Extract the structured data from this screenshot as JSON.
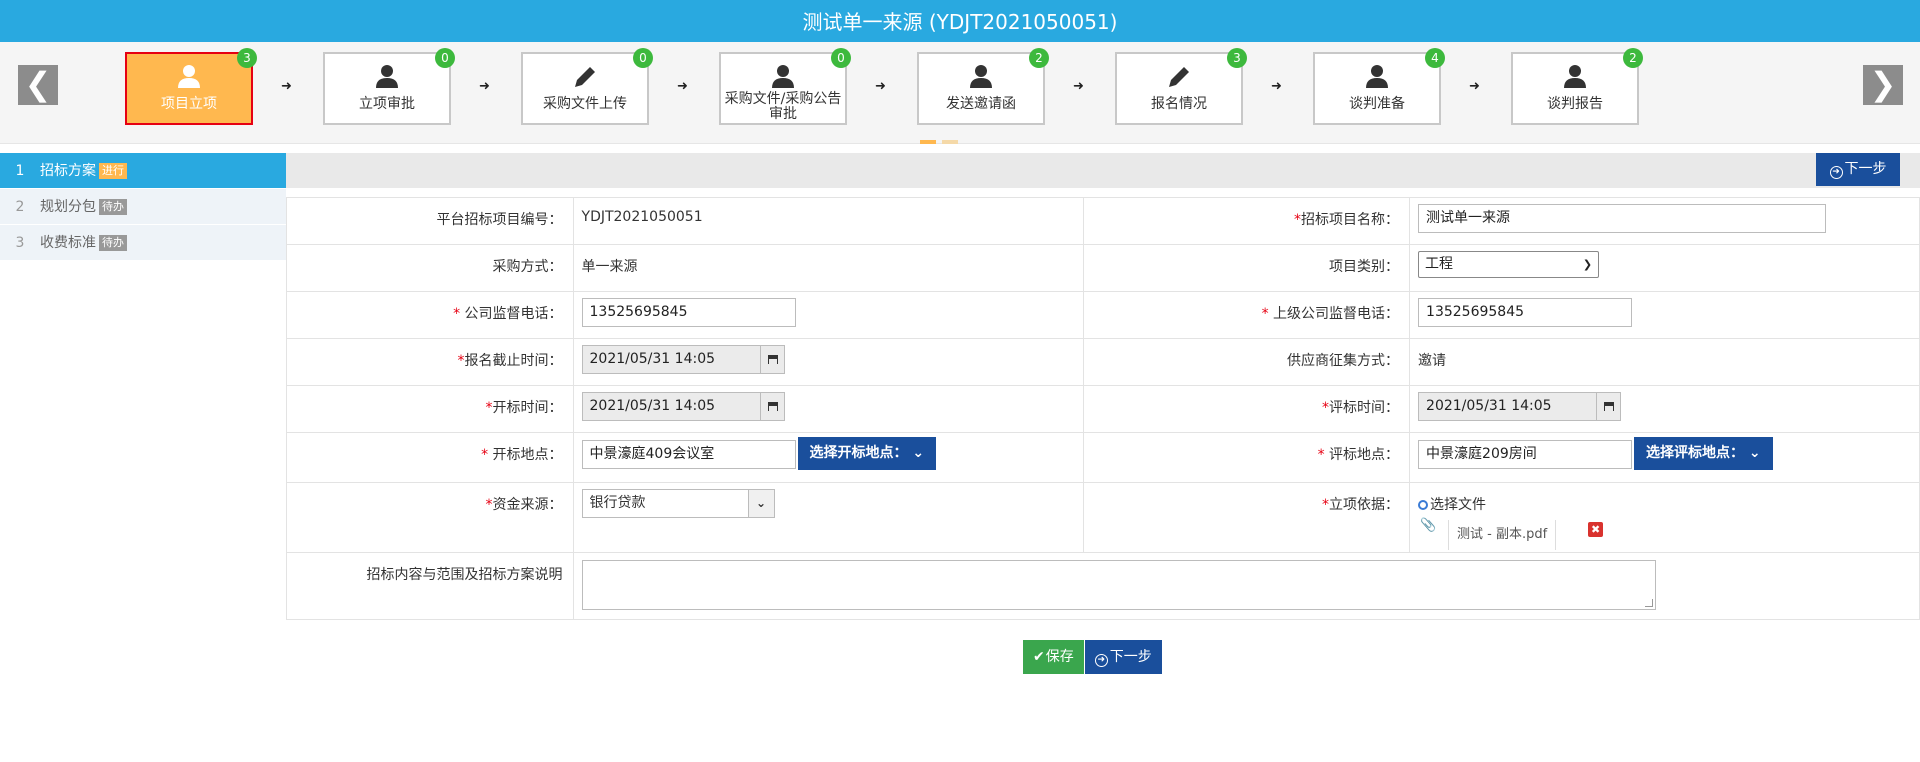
{
  "title": "测试单一来源 (YDJT2021050051)",
  "steps": [
    {
      "label": "项目立项",
      "badge": "3",
      "icon": "user-icon"
    },
    {
      "label": "立项审批",
      "badge": "0",
      "icon": "user-icon"
    },
    {
      "label": "采购文件上传",
      "badge": "0",
      "icon": "pencil-icon"
    },
    {
      "label": "采购文件/采购公告审批",
      "badge": "0",
      "icon": "user-icon"
    },
    {
      "label": "发送邀请函",
      "badge": "2",
      "icon": "user-icon"
    },
    {
      "label": "报名情况",
      "badge": "3",
      "icon": "pencil-icon"
    },
    {
      "label": "谈判准备",
      "badge": "4",
      "icon": "user-icon"
    },
    {
      "label": "谈判报告",
      "badge": "2",
      "icon": "user-icon"
    }
  ],
  "nav": {
    "prev": "❮",
    "next": "❯"
  },
  "sidebar": [
    {
      "num": "1",
      "label": "招标方案",
      "tag": "进行"
    },
    {
      "num": "2",
      "label": "规划分包",
      "tag": "待办"
    },
    {
      "num": "3",
      "label": "收费标准",
      "tag": "待办"
    }
  ],
  "toolbar": {
    "next_label": "下一步"
  },
  "form": {
    "project_no_label": "平台招标项目编号：",
    "project_no": "YDJT2021050051",
    "project_name_label": "招标项目名称：",
    "project_name": "测试单一来源",
    "purchase_method_label": "采购方式：",
    "purchase_method": "单一来源",
    "project_type_label": "项目类别：",
    "project_type": "工程",
    "company_phone_label": "公司监督电话：",
    "company_phone": "13525695845",
    "parent_phone_label": "上级公司监督电话：",
    "parent_phone": "13525695845",
    "signup_deadline_label": "报名截止时间：",
    "signup_deadline": "2021/05/31 14:05",
    "supplier_method_label": "供应商征集方式：",
    "supplier_method": "邀请",
    "open_time_label": "开标时间：",
    "open_time": "2021/05/31 14:05",
    "eval_time_label": "评标时间：",
    "eval_time": "2021/05/31 14:05",
    "open_place_label": "开标地点：",
    "open_place": "中景濠庭409会议室",
    "open_place_btn": "选择开标地点：",
    "eval_place_label": "评标地点：",
    "eval_place": "中景濠庭209房间",
    "eval_place_btn": "选择评标地点：",
    "fund_source_label": "资金来源：",
    "fund_source": "银行贷款",
    "basis_label": "立项依据：",
    "choose_file": "选择文件",
    "file_name": "测试 - 副本.pdf",
    "scope_label": "招标内容与范围及招标方案说明",
    "scope_value": ""
  },
  "bottom": {
    "save_label": "保存",
    "next_label": "下一步"
  },
  "colors": {
    "title_bar": "#29a9e0",
    "active_step": "#ffb84f",
    "badge": "#3db93d",
    "button_blue": "#1a4f9c",
    "button_green": "#3aa64d"
  }
}
